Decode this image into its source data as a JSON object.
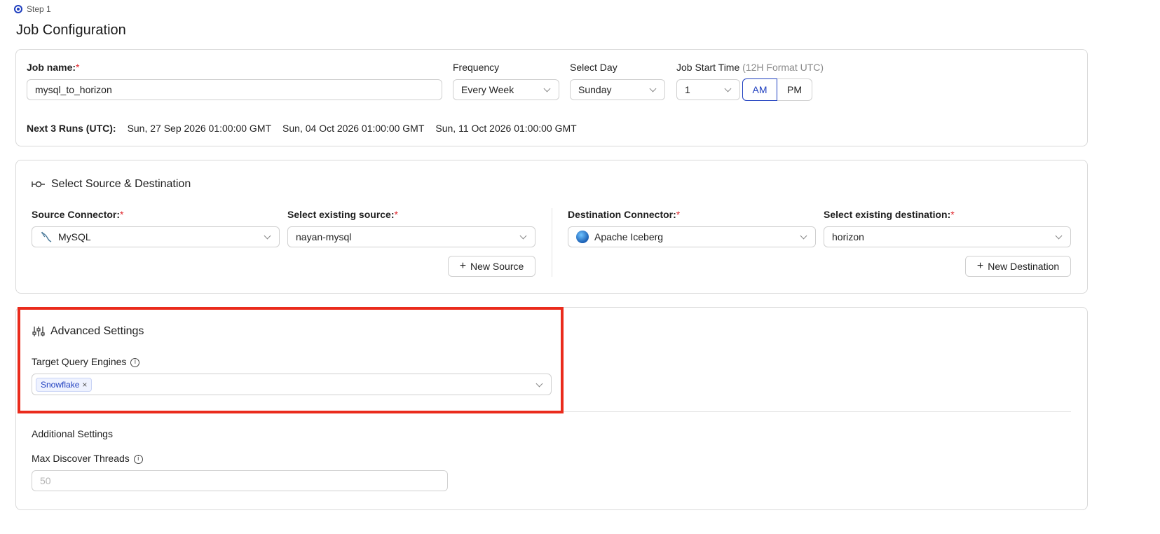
{
  "step": {
    "label": "Step 1"
  },
  "page_title": "Job Configuration",
  "job": {
    "name_label": "Job name:",
    "name_value": "mysql_to_horizon",
    "frequency_label": "Frequency",
    "frequency_value": "Every Week",
    "day_label": "Select Day",
    "day_value": "Sunday",
    "start_time_label": "Job Start Time",
    "start_time_hint": "(12H Format UTC)",
    "start_time_value": "1",
    "am_label": "AM",
    "pm_label": "PM",
    "runs_label": "Next 3 Runs (UTC):",
    "runs": [
      "Sun, 27 Sep 2026 01:00:00 GMT",
      "Sun, 04 Oct 2026 01:00:00 GMT",
      "Sun, 11 Oct 2026 01:00:00 GMT"
    ]
  },
  "source_dest": {
    "title": "Select Source & Destination",
    "source_connector_label": "Source Connector:",
    "source_connector_value": "MySQL",
    "existing_source_label": "Select existing source:",
    "existing_source_value": "nayan-mysql",
    "new_source_label": "New Source",
    "dest_connector_label": "Destination Connector:",
    "dest_connector_value": "Apache Iceberg",
    "existing_dest_label": "Select existing destination:",
    "existing_dest_value": "horizon",
    "new_dest_label": "New Destination"
  },
  "advanced": {
    "title": "Advanced Settings",
    "query_engines_label": "Target Query Engines",
    "tags": [
      "Snowflake"
    ],
    "additional_title": "Additional Settings",
    "max_threads_label": "Max Discover Threads",
    "max_threads_placeholder": "50"
  },
  "colors": {
    "accent": "#1f3fbf",
    "required": "#e0282e",
    "highlight": "#ea2b1c"
  }
}
